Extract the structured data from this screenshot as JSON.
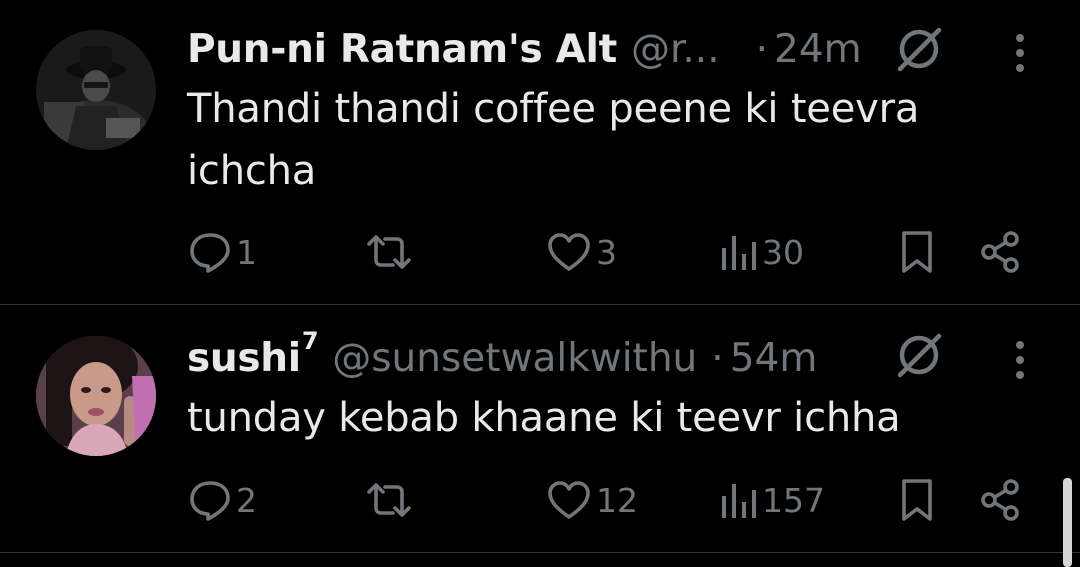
{
  "colors": {
    "background": "#000000",
    "primary_text": "#e7e9ea",
    "secondary_text": "#71767b",
    "divider": "#2f3336"
  },
  "posts": [
    {
      "display_name": "Pun-ni Ratnam's Alt",
      "handle": "@r...",
      "separator": "·",
      "time": "24m",
      "text_line_1": "Thandi thandi coffee peene ki teevra",
      "text_line_2": "ichcha",
      "replies": "1",
      "likes": "3",
      "views": "30",
      "icons": [
        "reply-icon",
        "repost-icon",
        "like-icon",
        "views-icon",
        "bookmark-icon",
        "share-icon",
        "grok-icon",
        "more-icon"
      ]
    },
    {
      "display_name": "sushi",
      "name_suffix": "7",
      "handle": "@sunsetwalkwithu",
      "separator": "·",
      "time": "54m",
      "text_line_1": "tunday kebab khaane ki teevr ichha",
      "replies": "2",
      "likes": "12",
      "views": "157",
      "icons": [
        "reply-icon",
        "repost-icon",
        "like-icon",
        "views-icon",
        "bookmark-icon",
        "share-icon",
        "grok-icon",
        "more-icon"
      ]
    }
  ]
}
